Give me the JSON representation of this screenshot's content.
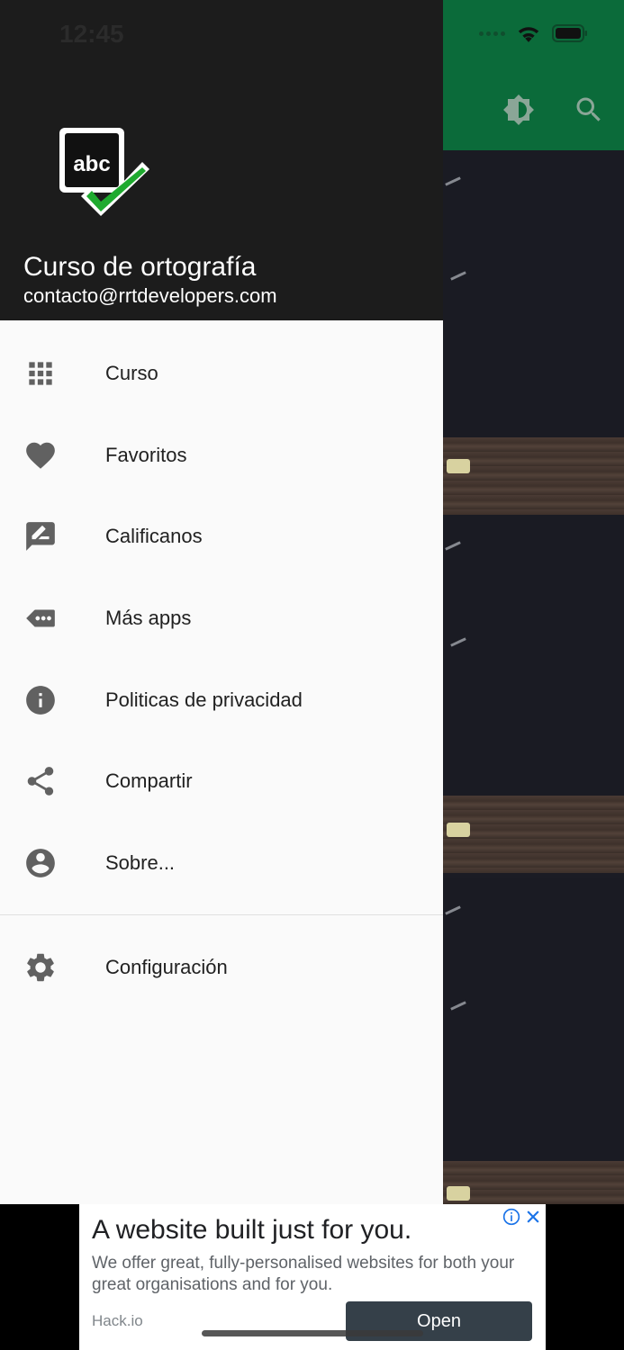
{
  "status_bar": {
    "time": "12:45"
  },
  "app_bar": {
    "icons": [
      "brightness-icon",
      "search-icon"
    ],
    "color": "#0b6b3a"
  },
  "drawer": {
    "header": {
      "title": "Curso de ortografía",
      "email": "contacto@rrtdevelopers.com",
      "logo_icon": "abc-check-logo",
      "logo_text": "abc"
    },
    "items": [
      {
        "label": "Curso",
        "icon": "grid-icon"
      },
      {
        "label": "Favoritos",
        "icon": "heart-icon"
      },
      {
        "label": "Calificanos",
        "icon": "rate-review-icon"
      },
      {
        "label": "Más apps",
        "icon": "more-apps-icon"
      },
      {
        "label": "Politicas de privacidad",
        "icon": "info-icon"
      },
      {
        "label": "Compartir",
        "icon": "share-icon"
      },
      {
        "label": "Sobre...",
        "icon": "account-circle-icon"
      }
    ],
    "settings": {
      "label": "Configuración",
      "icon": "gear-icon"
    }
  },
  "ad": {
    "title": "A website built just for you.",
    "description": "We offer great, fully-personalised websites for both your great organisations and for you.",
    "source": "Hack.io",
    "cta": "Open"
  },
  "colors": {
    "header_bg": "#1c1c1c",
    "drawer_bg": "#fafafa",
    "icon": "#616161",
    "logo_check": "#1faa2f"
  }
}
